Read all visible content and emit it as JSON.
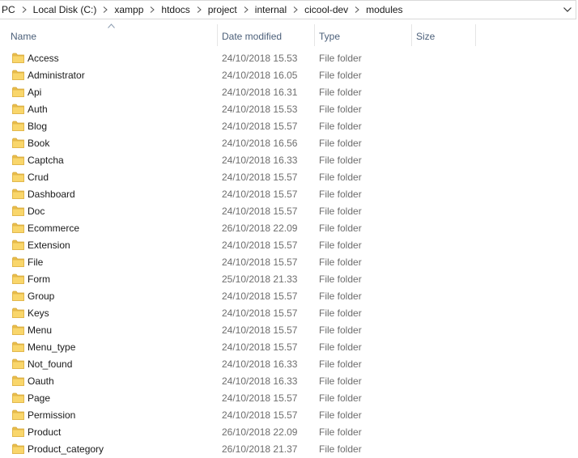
{
  "breadcrumb": [
    "PC",
    "Local Disk (C:)",
    "xampp",
    "htdocs",
    "project",
    "internal",
    "cicool-dev",
    "modules"
  ],
  "columns": {
    "name": "Name",
    "date_modified": "Date modified",
    "type": "Type",
    "size": "Size"
  },
  "sort": {
    "column": "name",
    "direction": "ascending"
  },
  "icons": {
    "folder": "folder-icon",
    "separator": "chevron-right-icon",
    "address_dropdown": "chevron-down-icon",
    "sort": "sort-up-icon"
  },
  "colors": {
    "folder_fill": "#f9d66b",
    "folder_tab": "#e9bd4b",
    "header_text": "#4c607a",
    "secondary_text": "#6d6d6d"
  },
  "files": [
    {
      "name": "Access",
      "date": "24/10/2018 15.53",
      "type": "File folder"
    },
    {
      "name": "Administrator",
      "date": "24/10/2018 16.05",
      "type": "File folder"
    },
    {
      "name": "Api",
      "date": "24/10/2018 16.31",
      "type": "File folder"
    },
    {
      "name": "Auth",
      "date": "24/10/2018 15.53",
      "type": "File folder"
    },
    {
      "name": "Blog",
      "date": "24/10/2018 15.57",
      "type": "File folder"
    },
    {
      "name": "Book",
      "date": "24/10/2018 16.56",
      "type": "File folder"
    },
    {
      "name": "Captcha",
      "date": "24/10/2018 16.33",
      "type": "File folder"
    },
    {
      "name": "Crud",
      "date": "24/10/2018 15.57",
      "type": "File folder"
    },
    {
      "name": "Dashboard",
      "date": "24/10/2018 15.57",
      "type": "File folder"
    },
    {
      "name": "Doc",
      "date": "24/10/2018 15.57",
      "type": "File folder"
    },
    {
      "name": "Ecommerce",
      "date": "26/10/2018 22.09",
      "type": "File folder"
    },
    {
      "name": "Extension",
      "date": "24/10/2018 15.57",
      "type": "File folder"
    },
    {
      "name": "File",
      "date": "24/10/2018 15.57",
      "type": "File folder"
    },
    {
      "name": "Form",
      "date": "25/10/2018 21.33",
      "type": "File folder"
    },
    {
      "name": "Group",
      "date": "24/10/2018 15.57",
      "type": "File folder"
    },
    {
      "name": "Keys",
      "date": "24/10/2018 15.57",
      "type": "File folder"
    },
    {
      "name": "Menu",
      "date": "24/10/2018 15.57",
      "type": "File folder"
    },
    {
      "name": "Menu_type",
      "date": "24/10/2018 15.57",
      "type": "File folder"
    },
    {
      "name": "Not_found",
      "date": "24/10/2018 16.33",
      "type": "File folder"
    },
    {
      "name": "Oauth",
      "date": "24/10/2018 16.33",
      "type": "File folder"
    },
    {
      "name": "Page",
      "date": "24/10/2018 15.57",
      "type": "File folder"
    },
    {
      "name": "Permission",
      "date": "24/10/2018 15.57",
      "type": "File folder"
    },
    {
      "name": "Product",
      "date": "26/10/2018 22.09",
      "type": "File folder"
    },
    {
      "name": "Product_category",
      "date": "26/10/2018 21.37",
      "type": "File folder"
    }
  ]
}
